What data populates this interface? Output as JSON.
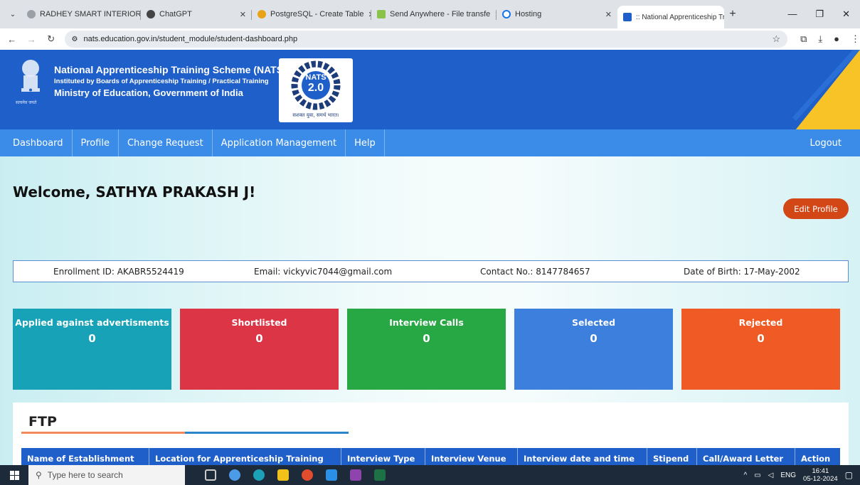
{
  "browser": {
    "tabs": [
      {
        "title": "RADHEY SMART INTERIORS",
        "active": false
      },
      {
        "title": "ChatGPT",
        "active": false
      },
      {
        "title": "PostgreSQL - Create Table",
        "active": false
      },
      {
        "title": "Send Anywhere - File transfe",
        "active": false
      },
      {
        "title": "Hosting",
        "active": false
      },
      {
        "title": ":: National Apprenticeship Tr",
        "active": true
      }
    ],
    "url": "nats.education.gov.in/student_module/student-dashboard.php"
  },
  "header": {
    "title": "National Apprenticeship Training Scheme (NATS)",
    "subtitle": "Instituted by Boards of Apprenticeship Training / Practical Training",
    "ministry": "Ministry of Education, Government of India",
    "logo_text": "NATS",
    "logo_version": "2.0",
    "emblem_caption": "सत्यमेव जयते",
    "logo_tagline": "सशक्त युवा, समर्थ भारत।"
  },
  "nav": {
    "items": [
      "Dashboard",
      "Profile",
      "Change Request",
      "Application Management",
      "Help"
    ],
    "logout": "Logout"
  },
  "profile": {
    "welcome": "Welcome, SATHYA PRAKASH J!",
    "edit_button": "Edit Profile",
    "enrollment": "Enrollment ID: AKABR5524419",
    "email": "Email: vickyvic7044@gmail.com",
    "contact": "Contact No.: 8147784657",
    "dob": "Date of Birth: 17-May-2002"
  },
  "stats": [
    {
      "label": "Applied against advertisments",
      "count": "0",
      "color": "#17a2b8"
    },
    {
      "label": "Shortlisted",
      "count": "0",
      "color": "#dc3545"
    },
    {
      "label": "Interview Calls",
      "count": "0",
      "color": "#28a745"
    },
    {
      "label": "Selected",
      "count": "0",
      "color": "#3d7fdc"
    },
    {
      "label": "Rejected",
      "count": "0",
      "color": "#f05a24"
    }
  ],
  "ftp": {
    "title": "FTP",
    "columns": [
      "Name of Establishment",
      "Location for Apprenticeship Training",
      "Interview Type",
      "Interview Venue",
      "Interview date and time",
      "Stipend",
      "Call/Award Letter",
      "Action"
    ]
  },
  "taskbar": {
    "search_placeholder": "Type here to search",
    "lang": "ENG",
    "time": "16:41",
    "date": "05-12-2024"
  }
}
